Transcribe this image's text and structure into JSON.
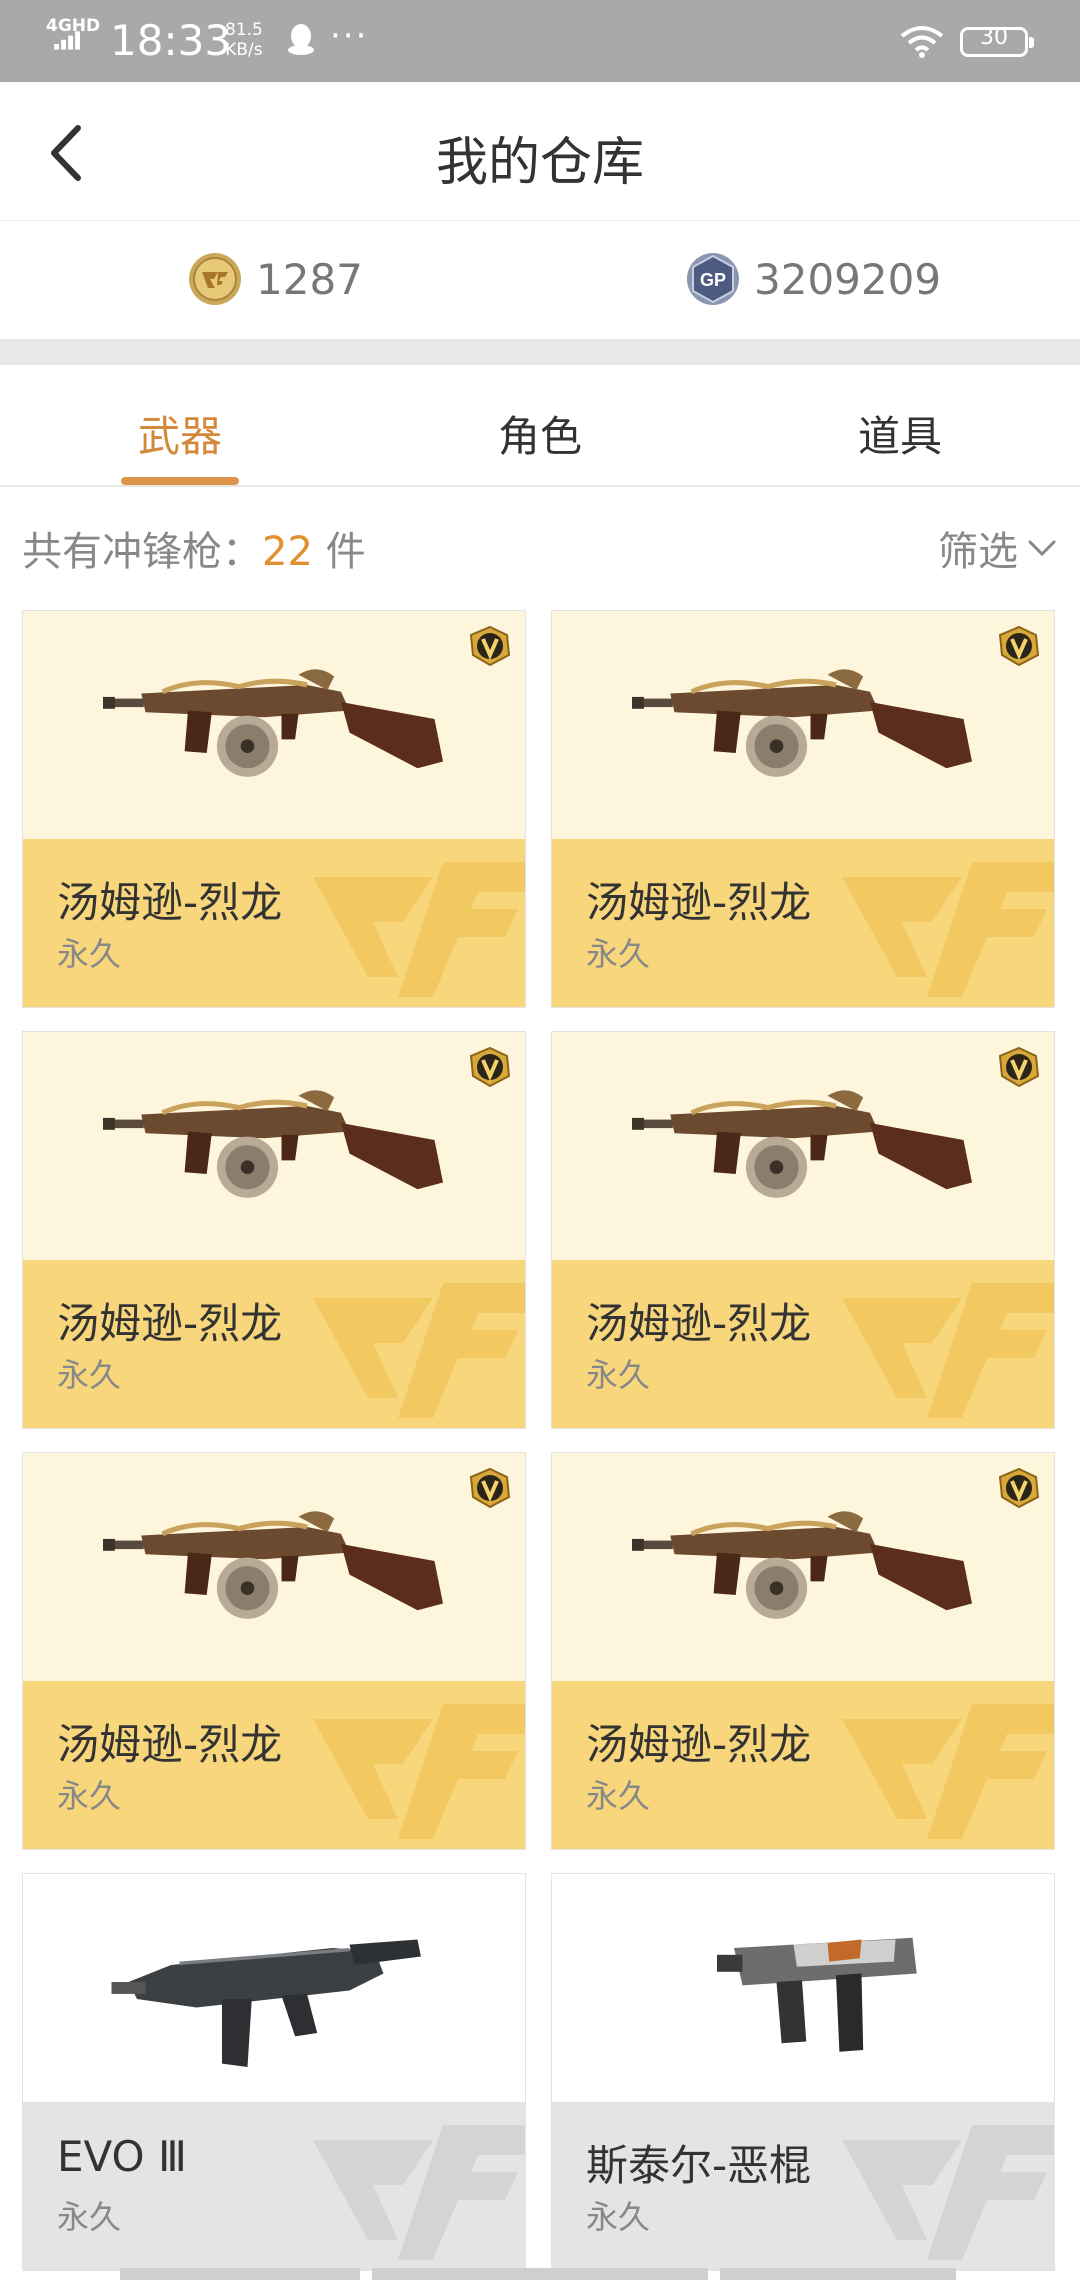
{
  "status_bar": {
    "network": "4GHD",
    "time": "18:33",
    "speed_value": "81.5",
    "speed_unit": "KB/s",
    "dots": "···",
    "battery": "30",
    "icons": [
      "signal-icon",
      "qq-icon",
      "wifi-icon",
      "battery-icon"
    ]
  },
  "header": {
    "title": "我的仓库",
    "back_icon": "chevron-left-icon"
  },
  "currency": {
    "cf_points": "1287",
    "gp_points": "3209209",
    "cf_icon": "cf-coin-icon",
    "gp_icon": "gp-coin-icon",
    "gp_badge_text": "GP"
  },
  "tabs": [
    {
      "label": "武器",
      "active": true
    },
    {
      "label": "角色",
      "active": false
    },
    {
      "label": "道具",
      "active": false
    }
  ],
  "summary": {
    "prefix": "共有冲锋枪：",
    "count": "22",
    "suffix": " 件",
    "filter_label": "筛选"
  },
  "colors": {
    "accent": "#e0934a",
    "count": "#e0902e",
    "gold_card_top": "#fef6dc",
    "gold_card_bottom": "#f8d77c",
    "grey_card_bottom": "#e5e3e3"
  },
  "items": [
    {
      "name": "汤姆逊-烈龙",
      "duration": "永久",
      "style": "gold",
      "vip": true,
      "weapon": "thompson-dragon"
    },
    {
      "name": "汤姆逊-烈龙",
      "duration": "永久",
      "style": "gold",
      "vip": true,
      "weapon": "thompson-dragon"
    },
    {
      "name": "汤姆逊-烈龙",
      "duration": "永久",
      "style": "gold",
      "vip": true,
      "weapon": "thompson-dragon"
    },
    {
      "name": "汤姆逊-烈龙",
      "duration": "永久",
      "style": "gold",
      "vip": true,
      "weapon": "thompson-dragon"
    },
    {
      "name": "汤姆逊-烈龙",
      "duration": "永久",
      "style": "gold",
      "vip": true,
      "weapon": "thompson-dragon"
    },
    {
      "name": "汤姆逊-烈龙",
      "duration": "永久",
      "style": "gold",
      "vip": true,
      "weapon": "thompson-dragon"
    },
    {
      "name": "EVO Ⅲ",
      "duration": "永久",
      "style": "grey",
      "vip": false,
      "weapon": "evo3"
    },
    {
      "name": "斯泰尔-恶棍",
      "duration": "永久",
      "style": "grey",
      "vip": false,
      "weapon": "steyr-tmp"
    }
  ]
}
